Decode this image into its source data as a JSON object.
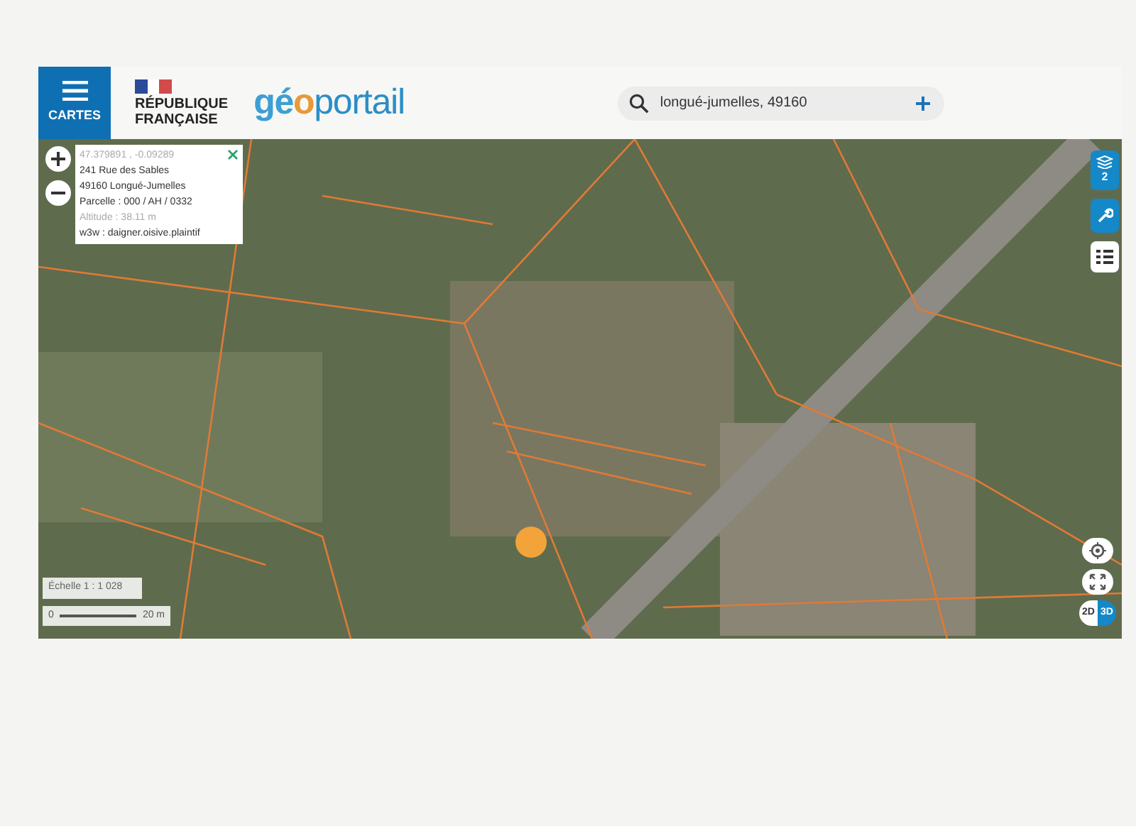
{
  "header": {
    "menu_label": "CARTES",
    "republic_lines": [
      "RÉPUBLIQUE",
      "FRANÇAISE"
    ],
    "logo_parts": [
      "gé",
      "o",
      "portail"
    ],
    "search": {
      "value": "longué-jumelles, 49160"
    }
  },
  "popup": {
    "coordinates": "47.379891 , -0.09289",
    "address_lines": [
      "241 Rue des Sables",
      "49160 Longué-Jumelles"
    ],
    "parcel": "Parcelle : 000 / AH / 0332",
    "altitude": "Altitude : 38.11 m",
    "w3w": "w3w : daigner.oisive.plaintif"
  },
  "scale": {
    "ratio": "Échelle 1 : 1 028",
    "start": "0",
    "end": "20 m"
  },
  "layers_count": "2",
  "view_modes": [
    {
      "label": "2D",
      "selected": false
    },
    {
      "label": "3D",
      "selected": true
    }
  ]
}
